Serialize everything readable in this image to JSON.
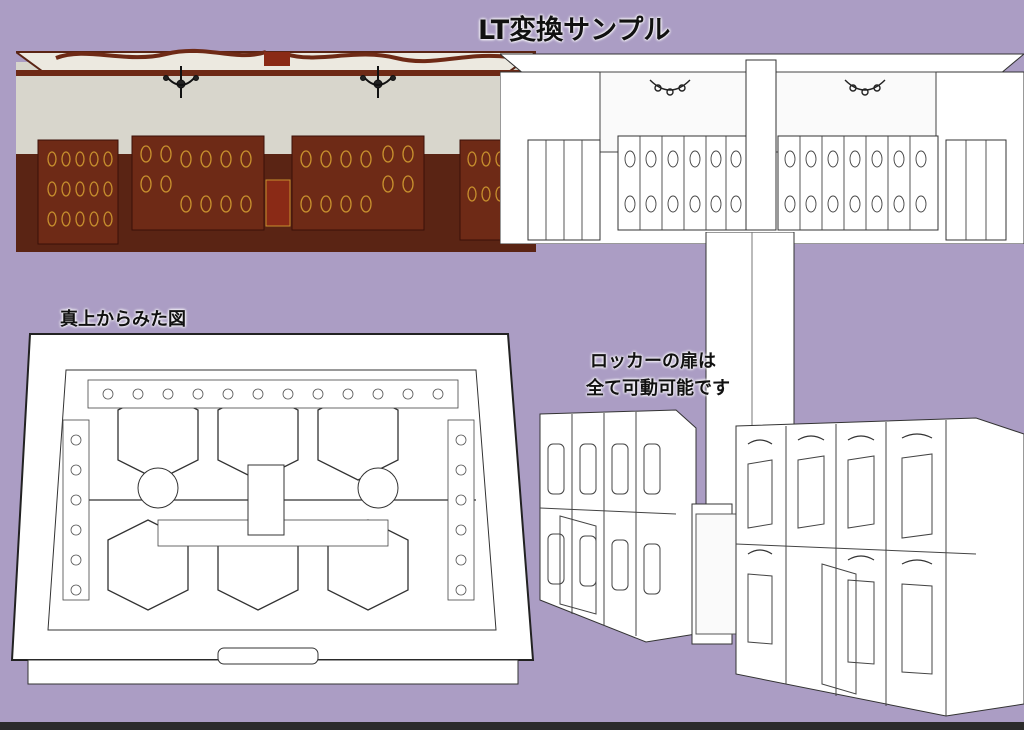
{
  "title": "LT変換サンプル",
  "top_view_label": "真上からみた図",
  "locker_note": [
    "ロッカーの扉は",
    "全て可動可能です"
  ],
  "colors": {
    "background": "#ab9dc4",
    "wall": "#d8d6cc",
    "wood": "#6e2a16",
    "trim": "#8a4a1f",
    "gold": "#c8902e",
    "lineart_fill": "#ffffff",
    "lineart_stroke": "#333333"
  }
}
